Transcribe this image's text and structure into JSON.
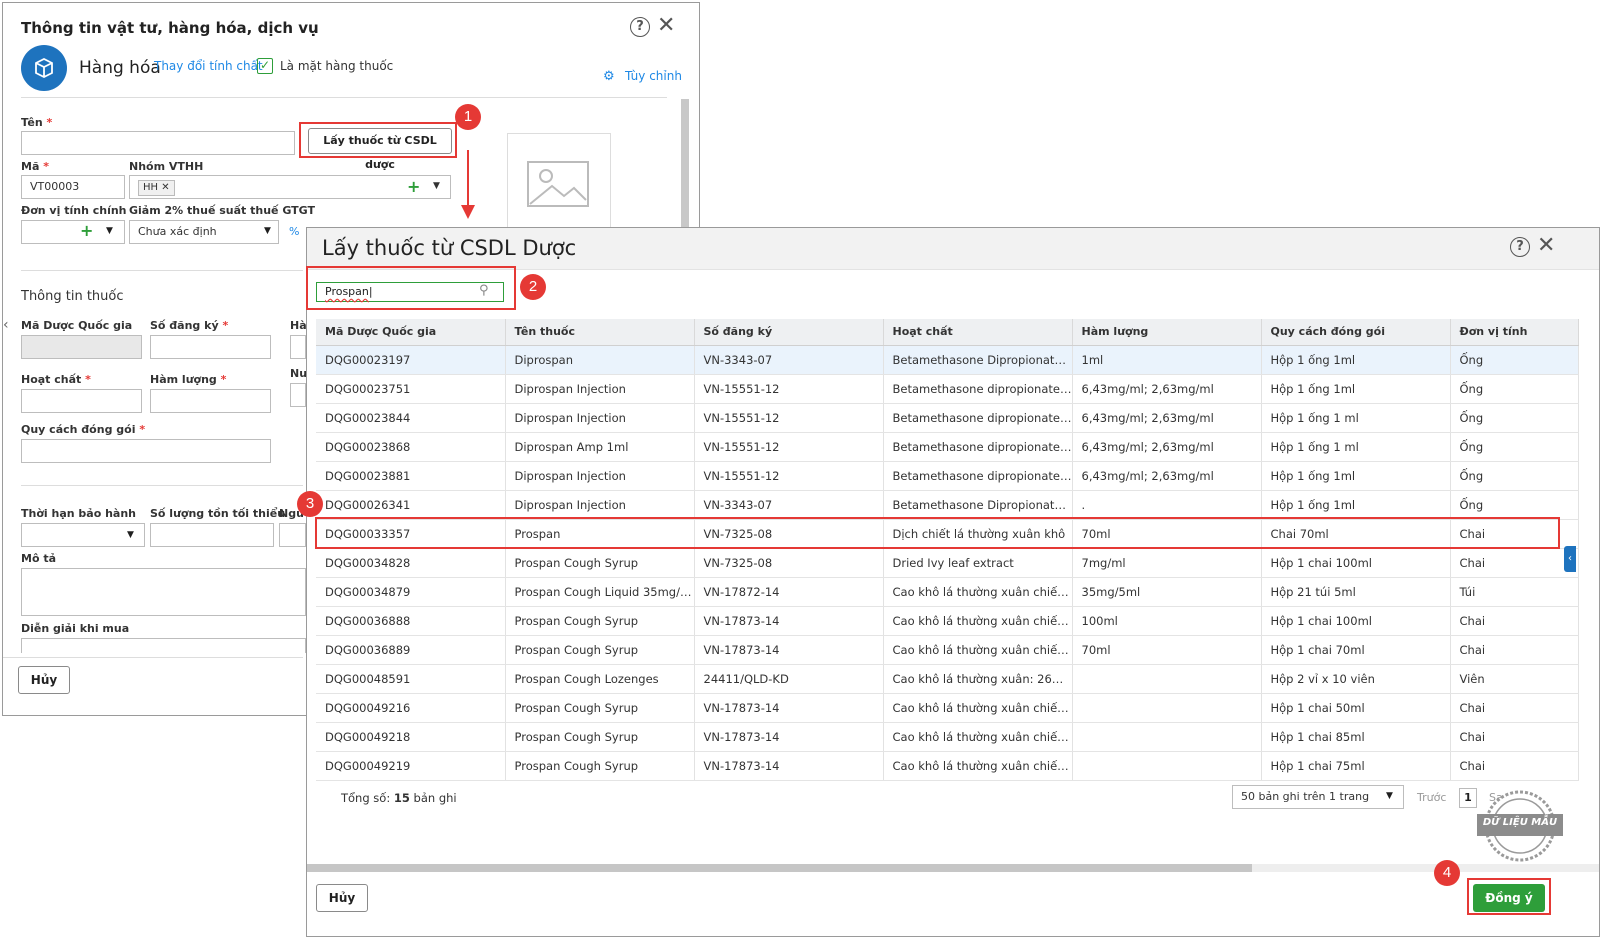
{
  "bg_dialog": {
    "title": "Thông tin vật tư, hàng hóa, dịch vụ",
    "help_icon": "?",
    "type_label": "Hàng hóa",
    "change_link": "Thay đổi tính chất",
    "is_drug_label": "Là mặt hàng thuốc",
    "customize_label": "Tùy chỉnh",
    "fields": {
      "name_label": "Tên",
      "fetch_button": "Lấy thuốc từ CSDL dược",
      "code_label": "Mã",
      "code_value": "VT00003",
      "group_label": "Nhóm VTHH",
      "group_chip": "HH",
      "unit_label": "Đơn vị tính chính",
      "vat_label": "Giảm 2% thuế suất thuế GTGT",
      "vat_value": "Chưa xác định",
      "section_drug": "Thông tin thuốc",
      "national_code_label": "Mã Dược Quốc gia",
      "reg_no_label": "Số đăng ký",
      "ha_cut": "Hà",
      "active_label": "Hoạt chất",
      "content_label": "Hàm lượng",
      "nu_cut": "Nu",
      "packing_label": "Quy cách đóng gói",
      "warranty_label": "Thời hạn bảo hành",
      "min_stock_label": "Số lượng tồn tối thiểu",
      "ngu_cut": "Ngu",
      "desc_label": "Mô tả",
      "purchase_desc_label": "Diễn giải khi mua"
    },
    "cancel_button": "Hủy"
  },
  "fg_dialog": {
    "title": "Lấy thuốc từ CSDL Dược",
    "help_icon": "?",
    "search_value": "Prospan",
    "columns": [
      "Mã Dược Quốc gia",
      "Tên thuốc",
      "Số đăng ký",
      "Hoạt chất",
      "Hàm lượng",
      "Quy cách đóng gói",
      "Đơn vị tính"
    ],
    "rows": [
      [
        "DQG00023197",
        "Diprospan",
        "VN-3343-07",
        "Betamethasone Dipropionate, ...",
        "1ml",
        "Hộp 1 ống 1ml",
        "Ống"
      ],
      [
        "DQG00023751",
        "Diprospan Injection",
        "VN-15551-12",
        "Betamethasone dipropionate, ...",
        "6,43mg/ml; 2,63mg/ml",
        "Hộp 1 ống 1ml",
        "Ống"
      ],
      [
        "DQG00023844",
        "Diprospan Injection",
        "VN-15551-12",
        "Betamethasone dipropionate, ...",
        "6,43mg/ml; 2,63mg/ml",
        "Hộp 1 ống 1 ml",
        "Ống"
      ],
      [
        "DQG00023868",
        "Diprospan Amp 1ml",
        "VN-15551-12",
        "Betamethasone dipropionate, ...",
        "6,43mg/ml; 2,63mg/ml",
        "Hộp 1 ống 1 ml",
        "Ống"
      ],
      [
        "DQG00023881",
        "Diprospan Injection",
        "VN-15551-12",
        "Betamethasone dipropionate, ...",
        "6,43mg/ml; 2,63mg/ml",
        "Hộp 1 ống 1ml",
        "Ống"
      ],
      [
        "DQG00026341",
        "Diprospan Injection",
        "VN-3343-07",
        "Betamethasone Dipropionate, ...",
        ".",
        "Hộp 1 ống 1ml",
        "Ống"
      ],
      [
        "DQG00033357",
        "Prospan",
        "VN-7325-08",
        "Dịch chiết lá thường xuân khô",
        "70ml",
        "Chai 70ml",
        "Chai"
      ],
      [
        "DQG00034828",
        "Prospan Cough Syrup",
        "VN-7325-08",
        "Dried Ivy leaf extract",
        "7mg/ml",
        "Hộp 1 chai 100ml",
        "Chai"
      ],
      [
        "DQG00034879",
        "Prospan Cough Liquid 35mg/5...",
        "VN-17872-14",
        "Cao khô lá thường xuân chiết x...",
        "35mg/5ml",
        "Hộp 21 túi 5ml",
        "Túi"
      ],
      [
        "DQG00036888",
        "Prospan Cough Syrup",
        "VN-17873-14",
        "Cao khô lá thường xuân chiết ...",
        "100ml",
        "Hộp 1 chai 100ml",
        "Chai"
      ],
      [
        "DQG00036889",
        "Prospan Cough Syrup",
        "VN-17873-14",
        "Cao khô lá thường xuân chiết ...",
        "70ml",
        "Hộp 1 chai 70ml",
        "Chai"
      ],
      [
        "DQG00048591",
        "Prospan Cough Lozenges",
        "24411/QLD-KD",
        "Cao khô lá thường xuân: 26mg...",
        "",
        "Hộp 2 vỉ x 10 viên",
        "Viên"
      ],
      [
        "DQG00049216",
        "Prospan Cough Syrup",
        "VN-17873-14",
        "Cao khô lá thường xuân chiết ...",
        "",
        "Hộp 1 chai 50ml",
        "Chai"
      ],
      [
        "DQG00049218",
        "Prospan Cough Syrup",
        "VN-17873-14",
        "Cao khô lá thường xuân chiết ...",
        "",
        "Hộp 1 chai 85ml",
        "Chai"
      ],
      [
        "DQG00049219",
        "Prospan Cough Syrup",
        "VN-17873-14",
        "Cao khô lá thường xuân chiết ...",
        "",
        "Hộp 1 chai 75ml",
        "Chai"
      ]
    ],
    "total_prefix": "Tổng số:",
    "total_count": "15",
    "total_suffix": "bản ghi",
    "page_size": "50 bản ghi trên 1 trang",
    "prev_label": "Trước",
    "page_number": "1",
    "next_cut": "Sa",
    "cancel_button": "Hủy",
    "ok_button": "Đồng ý",
    "watermark": "DỮ LIỆU MẪU"
  },
  "steps": [
    "1",
    "2",
    "3",
    "4"
  ],
  "colors": {
    "accent": "#1e73be",
    "link": "#1e88e5",
    "highlight": "#e53935",
    "ok": "#2e9e3a"
  }
}
